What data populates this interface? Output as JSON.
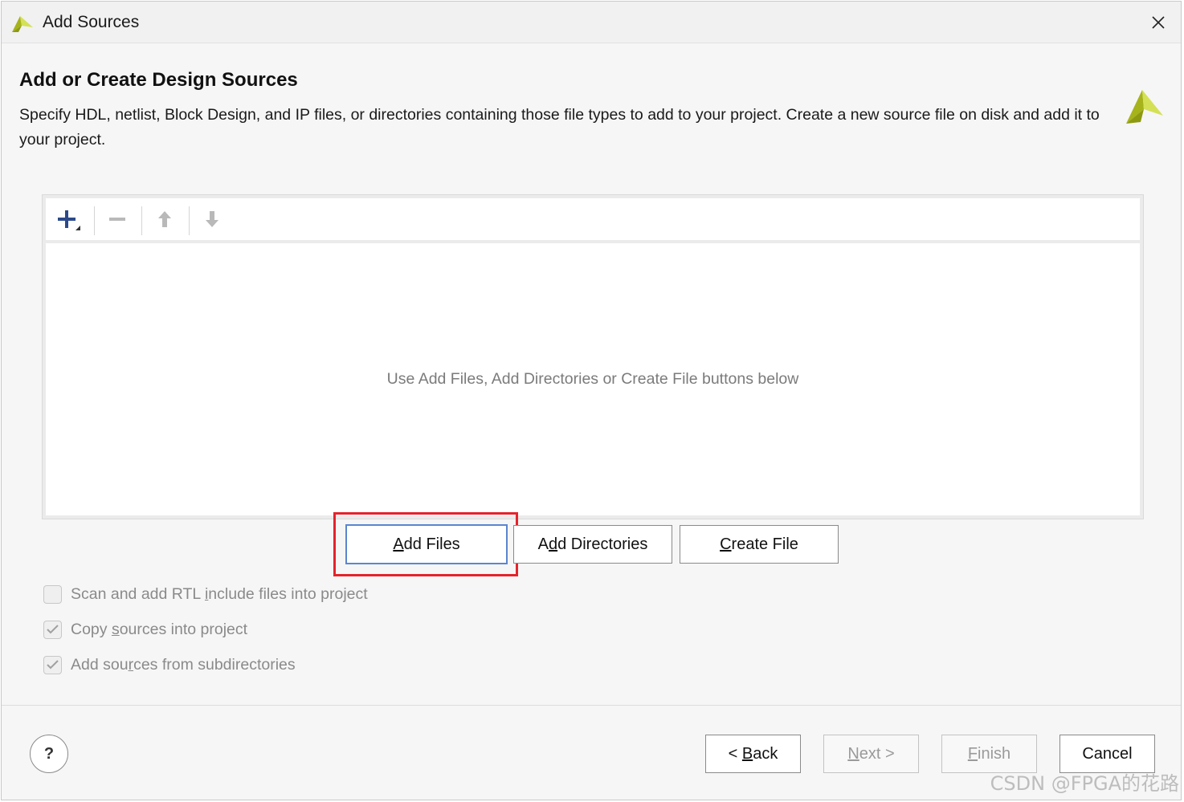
{
  "window": {
    "title": "Add Sources",
    "close_symbol": "✕"
  },
  "header": {
    "heading": "Add or Create Design Sources",
    "description": "Specify HDL, netlist, Block Design, and IP files, or directories containing those file types to add to your project. Create a new source file on disk and add it to your project."
  },
  "sources_panel": {
    "empty_hint": "Use Add Files, Add Directories or Create File buttons below",
    "toolbar_icons": [
      "add-icon",
      "remove-icon",
      "move-up-icon",
      "move-down-icon"
    ]
  },
  "actions": {
    "add_files": {
      "mnemonic": "A",
      "rest": "dd Files"
    },
    "add_directories": {
      "pre": "A",
      "mnemonic": "d",
      "rest": "d Directories"
    },
    "create_file": {
      "mnemonic": "C",
      "rest": "reate File"
    }
  },
  "options": [
    {
      "pre": "Scan and add RTL ",
      "mnemonic": "i",
      "rest": "nclude files into project",
      "checked": false
    },
    {
      "pre": "Copy ",
      "mnemonic": "s",
      "rest": "ources into project",
      "checked": true
    },
    {
      "pre": "Add sou",
      "mnemonic": "r",
      "rest": "ces from subdirectories",
      "checked": true
    }
  ],
  "footer": {
    "help": "?",
    "back": {
      "pre": "< ",
      "mnemonic": "B",
      "rest": "ack"
    },
    "next": {
      "mnemonic": "N",
      "rest": "ext >"
    },
    "finish": {
      "mnemonic": "F",
      "rest": "inish"
    },
    "cancel": "Cancel"
  },
  "watermark": "CSDN @FPGA的花路",
  "colors": {
    "highlight": "#e4232c",
    "accent": "#5a86d0",
    "logo_primary": "#a6b31b",
    "logo_light": "#d4e157"
  }
}
